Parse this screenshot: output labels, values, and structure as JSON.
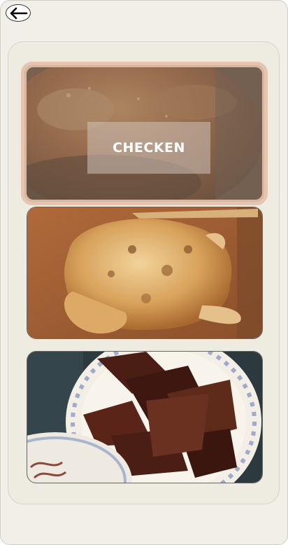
{
  "header": {
    "back_icon": "arrow-left-icon"
  },
  "cards": [
    {
      "label": "CHECKEN",
      "image": "roast-chicken-closeup",
      "selected": true
    },
    {
      "label": "",
      "image": "roast-chicken-board",
      "selected": false
    },
    {
      "label": "",
      "image": "grilled-beef-plate",
      "selected": false
    }
  ],
  "colors": {
    "background": "#f1efe7",
    "panel": "#eeebe0",
    "selected_border": "#e5c5b0"
  }
}
